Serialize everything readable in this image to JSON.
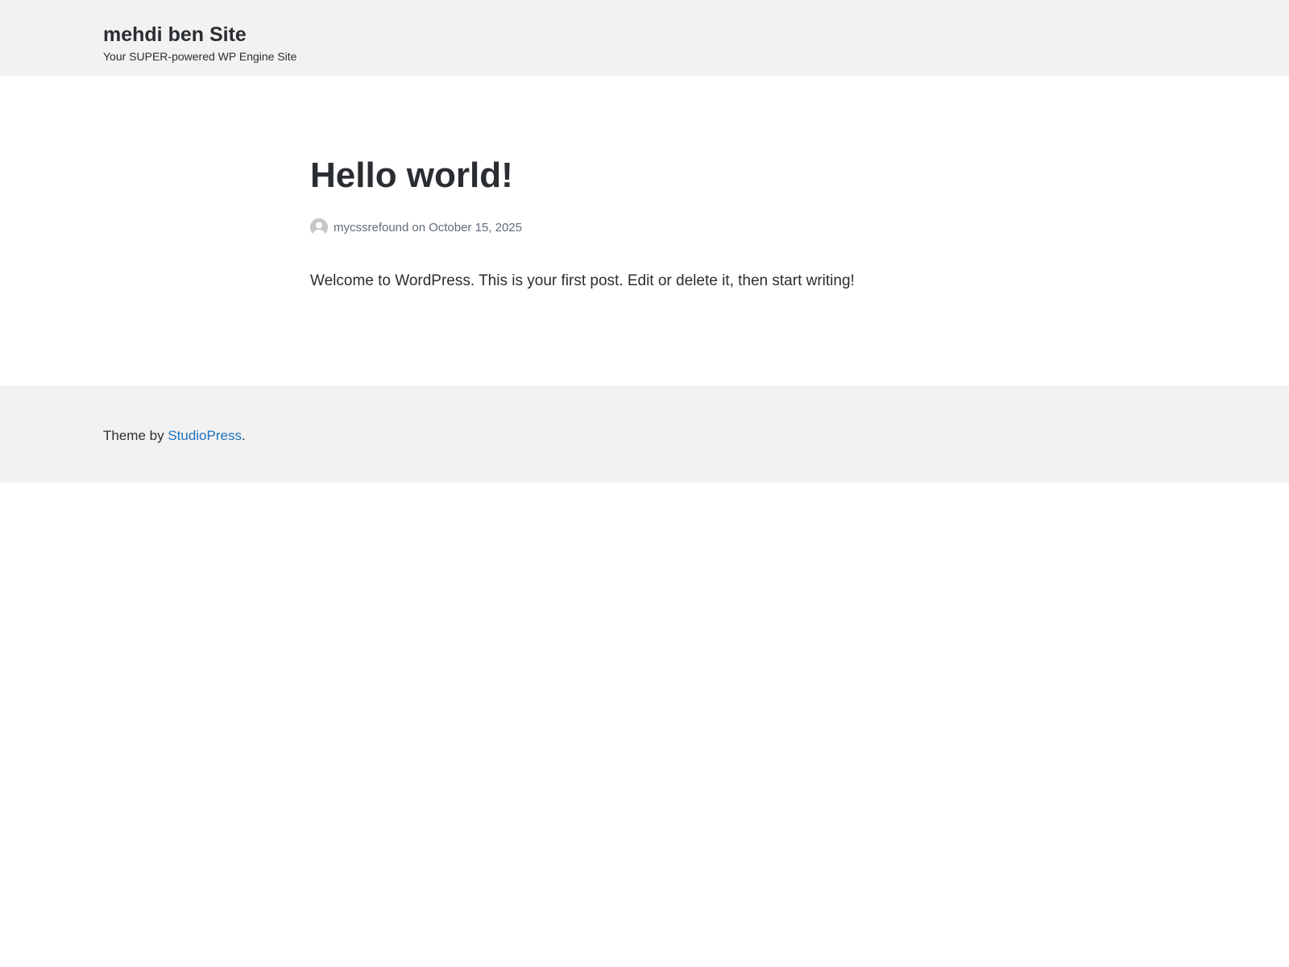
{
  "header": {
    "site_title": "mehdi ben Site",
    "tagline": "Your SUPER-powered WP Engine Site"
  },
  "post": {
    "title": "Hello world!",
    "author": "mycssrefound",
    "on_text": "on",
    "date": "October 15, 2025",
    "content": "Welcome to WordPress. This is your first post. Edit or delete it, then start writing!",
    "avatar_icon": "user-avatar-icon"
  },
  "footer": {
    "prefix": "Theme by ",
    "link_text": "StudioPress",
    "suffix": "."
  },
  "colors": {
    "background": "#ffffff",
    "header_footer_bg": "#f2f2f2",
    "text": "#2a2d31",
    "meta_text": "#646c77",
    "link": "#1e73be"
  }
}
